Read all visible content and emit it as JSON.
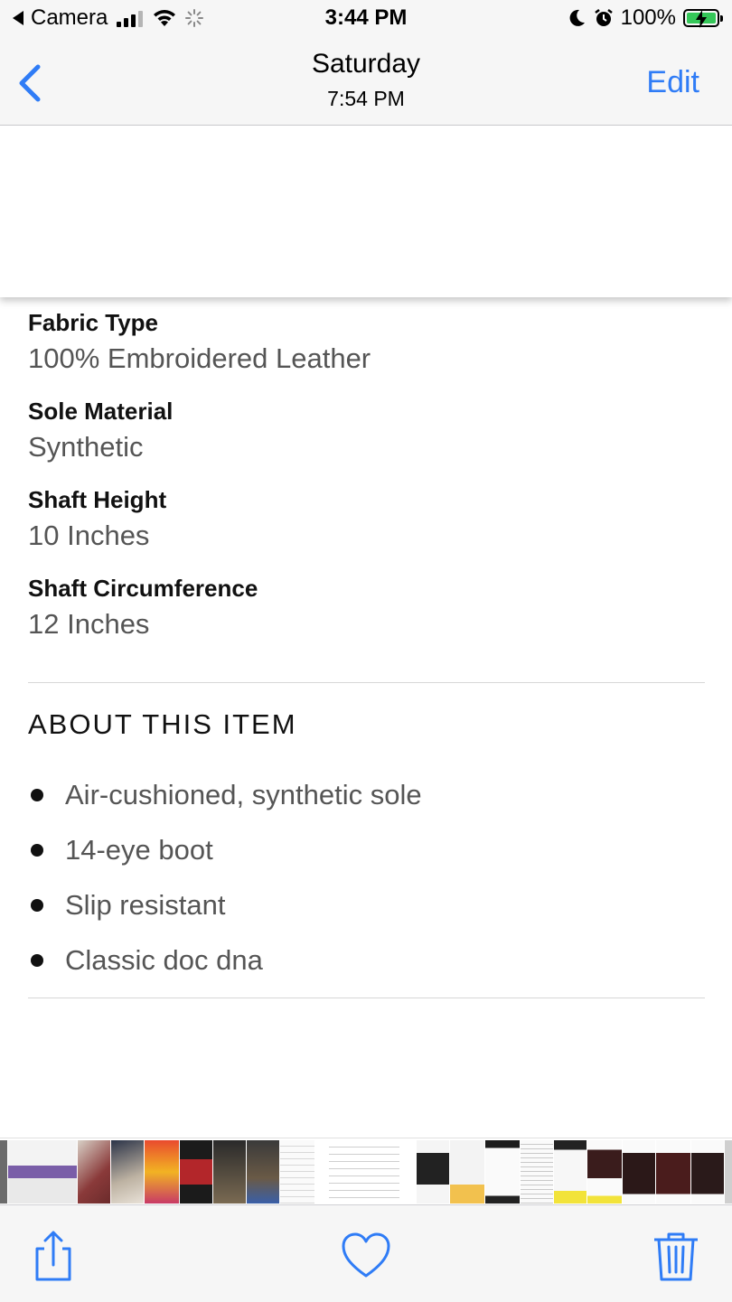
{
  "status_bar": {
    "back_app": "Camera",
    "time": "3:44 PM",
    "battery": "100%"
  },
  "nav": {
    "title": "Saturday",
    "subtitle": "7:54 PM",
    "edit_label": "Edit"
  },
  "specs": [
    {
      "label": "Fabric Type",
      "value": "100% Embroidered Leather"
    },
    {
      "label": "Sole Material",
      "value": "Synthetic"
    },
    {
      "label": "Shaft Height",
      "value": "10 Inches"
    },
    {
      "label": "Shaft Circumference",
      "value": "12 Inches"
    }
  ],
  "about": {
    "title": "ABOUT THIS ITEM",
    "bullets": [
      "Air-cushioned, synthetic sole",
      "14-eye boot",
      "Slip resistant",
      "Classic doc dna"
    ]
  },
  "colors": {
    "accent": "#2f7cf6",
    "battery_green": "#35c759",
    "bar_bg": "#f6f6f6"
  },
  "icons": {
    "back": "chevron-left-icon",
    "share": "share-icon",
    "favorite": "heart-icon",
    "delete": "trash-icon"
  }
}
